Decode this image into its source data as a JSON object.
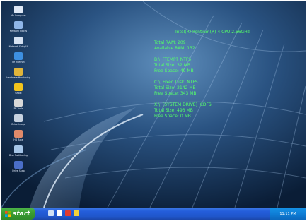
{
  "desktop_icons": [
    {
      "label": "My Computer",
      "icon": "computer-icon",
      "color": "#dfe8f5"
    },
    {
      "label": "Network Places",
      "icon": "network-icon",
      "color": "#8fb6e8"
    },
    {
      "label": "Network SetupUI",
      "icon": "setup-icon",
      "color": "#d6e2f2"
    },
    {
      "label": "Pe Internet",
      "icon": "globe-icon",
      "color": "#3d8fe0"
    },
    {
      "label": "Hardware Monitoring",
      "icon": "monitoring-icon",
      "color": "#e0b43a"
    },
    {
      "label": "Ghost",
      "icon": "ghost-icon",
      "color": "#f2c41d"
    },
    {
      "label": "PE Tools",
      "icon": "tools-icon",
      "color": "#d8d8d8"
    },
    {
      "label": "Drive Image",
      "icon": "drive-icon",
      "color": "#c7d2e0"
    },
    {
      "label": "HD Tune",
      "icon": "disk-icon",
      "color": "#e08a6a"
    },
    {
      "label": "Disk Partitioning",
      "icon": "partition-icon",
      "color": "#a6c6e8"
    },
    {
      "label": "Drive Snap",
      "icon": "snapshot-icon",
      "color": "#4a6ec8"
    }
  ],
  "system_info": {
    "cpu": "Intel(R) Pentium(R) 4 CPU 2.66GHz",
    "lines": [
      "Total RAM: 209",
      "Available RAM: 132",
      "",
      "B:\\  [TEMP]  NTFS",
      "Total Size: 32 MB",
      "Free Space: 49 MB",
      "",
      "C:\\  Fixed Disk  NTFS",
      "Total Size: 2142 MB",
      "Free Space: 343 MB",
      "",
      "X:\\  [SYSTEM DRIVE]  CDFS",
      "Total Size: 493 MB",
      "Free Space: 0 MB"
    ]
  },
  "taskbar": {
    "start_label": "start",
    "quick_launch": [
      {
        "icon": "show-desktop-icon",
        "color": "#cfe0f5"
      },
      {
        "icon": "explorer-icon",
        "color": "#ffffff"
      },
      {
        "icon": "tools-icon",
        "color": "#e23b2e"
      },
      {
        "icon": "app-icon",
        "color": "#f4d23a"
      }
    ],
    "clock": "11:11 PM"
  },
  "colors": {
    "info_text": "#54ff68",
    "taskbar": "#245edb",
    "start": "#3a9e33",
    "tray": "#0e7ad2"
  }
}
